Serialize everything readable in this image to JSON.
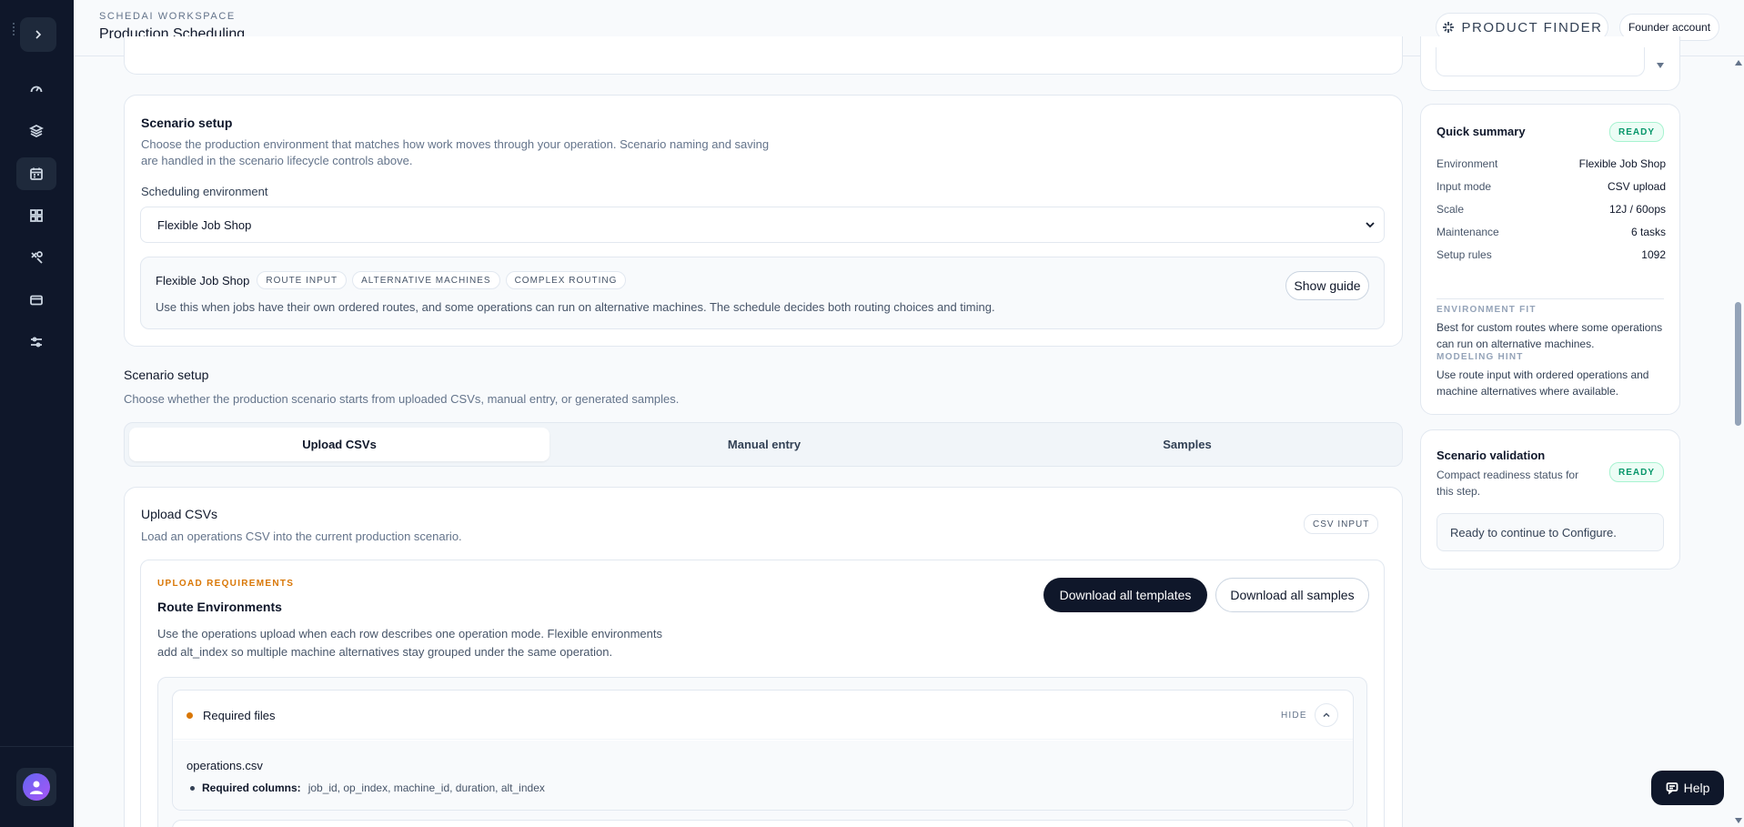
{
  "header": {
    "eyebrow": "SCHEDAI WORKSPACE",
    "title": "Production Scheduling",
    "product_finder": "PRODUCT FINDER",
    "account": "Founder account"
  },
  "rail": {
    "expand_icon": "chevron-right-icon",
    "items": [
      "dashboard-icon",
      "layers-icon",
      "calendar-icon",
      "apps-icon",
      "tools-icon",
      "card-icon",
      "sliders-icon"
    ],
    "active": "calendar-icon"
  },
  "env_card": {
    "title": "Scenario setup",
    "desc": "Choose the production environment that matches how work moves through your operation. Scenario naming and saving are handled in the scenario lifecycle controls above.",
    "field_label": "Scheduling environment",
    "selected": "Flexible Job Shop",
    "info": {
      "name": "Flexible Job Shop",
      "tags": [
        "ROUTE INPUT",
        "ALTERNATIVE MACHINES",
        "COMPLEX ROUTING"
      ],
      "desc": "Use this when jobs have their own ordered routes, and some operations can run on alternative machines. The schedule decides both routing choices and timing.",
      "guide_button": "Show guide"
    }
  },
  "input_section": {
    "title": "Scenario setup",
    "desc": "Choose whether the production scenario starts from uploaded CSVs, manual entry, or generated samples.",
    "tabs": [
      "Upload CSVs",
      "Manual entry",
      "Samples"
    ],
    "active_tab": "Upload CSVs"
  },
  "upload_card": {
    "title": "Upload CSVs",
    "desc": "Load an operations CSV into the current production scenario.",
    "badge": "CSV INPUT",
    "req": {
      "eyebrow": "UPLOAD REQUIREMENTS",
      "title": "Route Environments",
      "desc": "Use the operations upload when each row describes one operation mode. Flexible environments add alt_index so multiple machine alternatives stay grouped under the same operation.",
      "download_templates": "Download all templates",
      "download_samples": "Download all samples",
      "files_title": "Required files",
      "hide_label": "HIDE",
      "file_name": "operations.csv",
      "columns_label": "Required columns:",
      "columns": "job_id, op_index, machine_id, duration, alt_index"
    }
  },
  "summary": {
    "title": "Quick summary",
    "status": "READY",
    "rows": [
      {
        "k": "Environment",
        "v": "Flexible Job Shop"
      },
      {
        "k": "Input mode",
        "v": "CSV upload"
      },
      {
        "k": "Scale",
        "v": "12J / 60ops"
      },
      {
        "k": "Maintenance",
        "v": "6 tasks"
      },
      {
        "k": "Setup rules",
        "v": "1092"
      }
    ],
    "fit_label": "ENVIRONMENT FIT",
    "fit_text": "Best for custom routes where some operations can run on alternative machines.",
    "hint_label": "MODELING HINT",
    "hint_text": "Use route input with ordered operations and machine alternatives where available."
  },
  "validation": {
    "title": "Scenario validation",
    "desc": "Compact readiness status for this step.",
    "status": "READY",
    "message": "Ready to continue to Configure."
  },
  "help": {
    "label": "Help"
  },
  "colors": {
    "accent_dark": "#0f172a",
    "ready_green": "#059669",
    "amber": "#d97706"
  }
}
